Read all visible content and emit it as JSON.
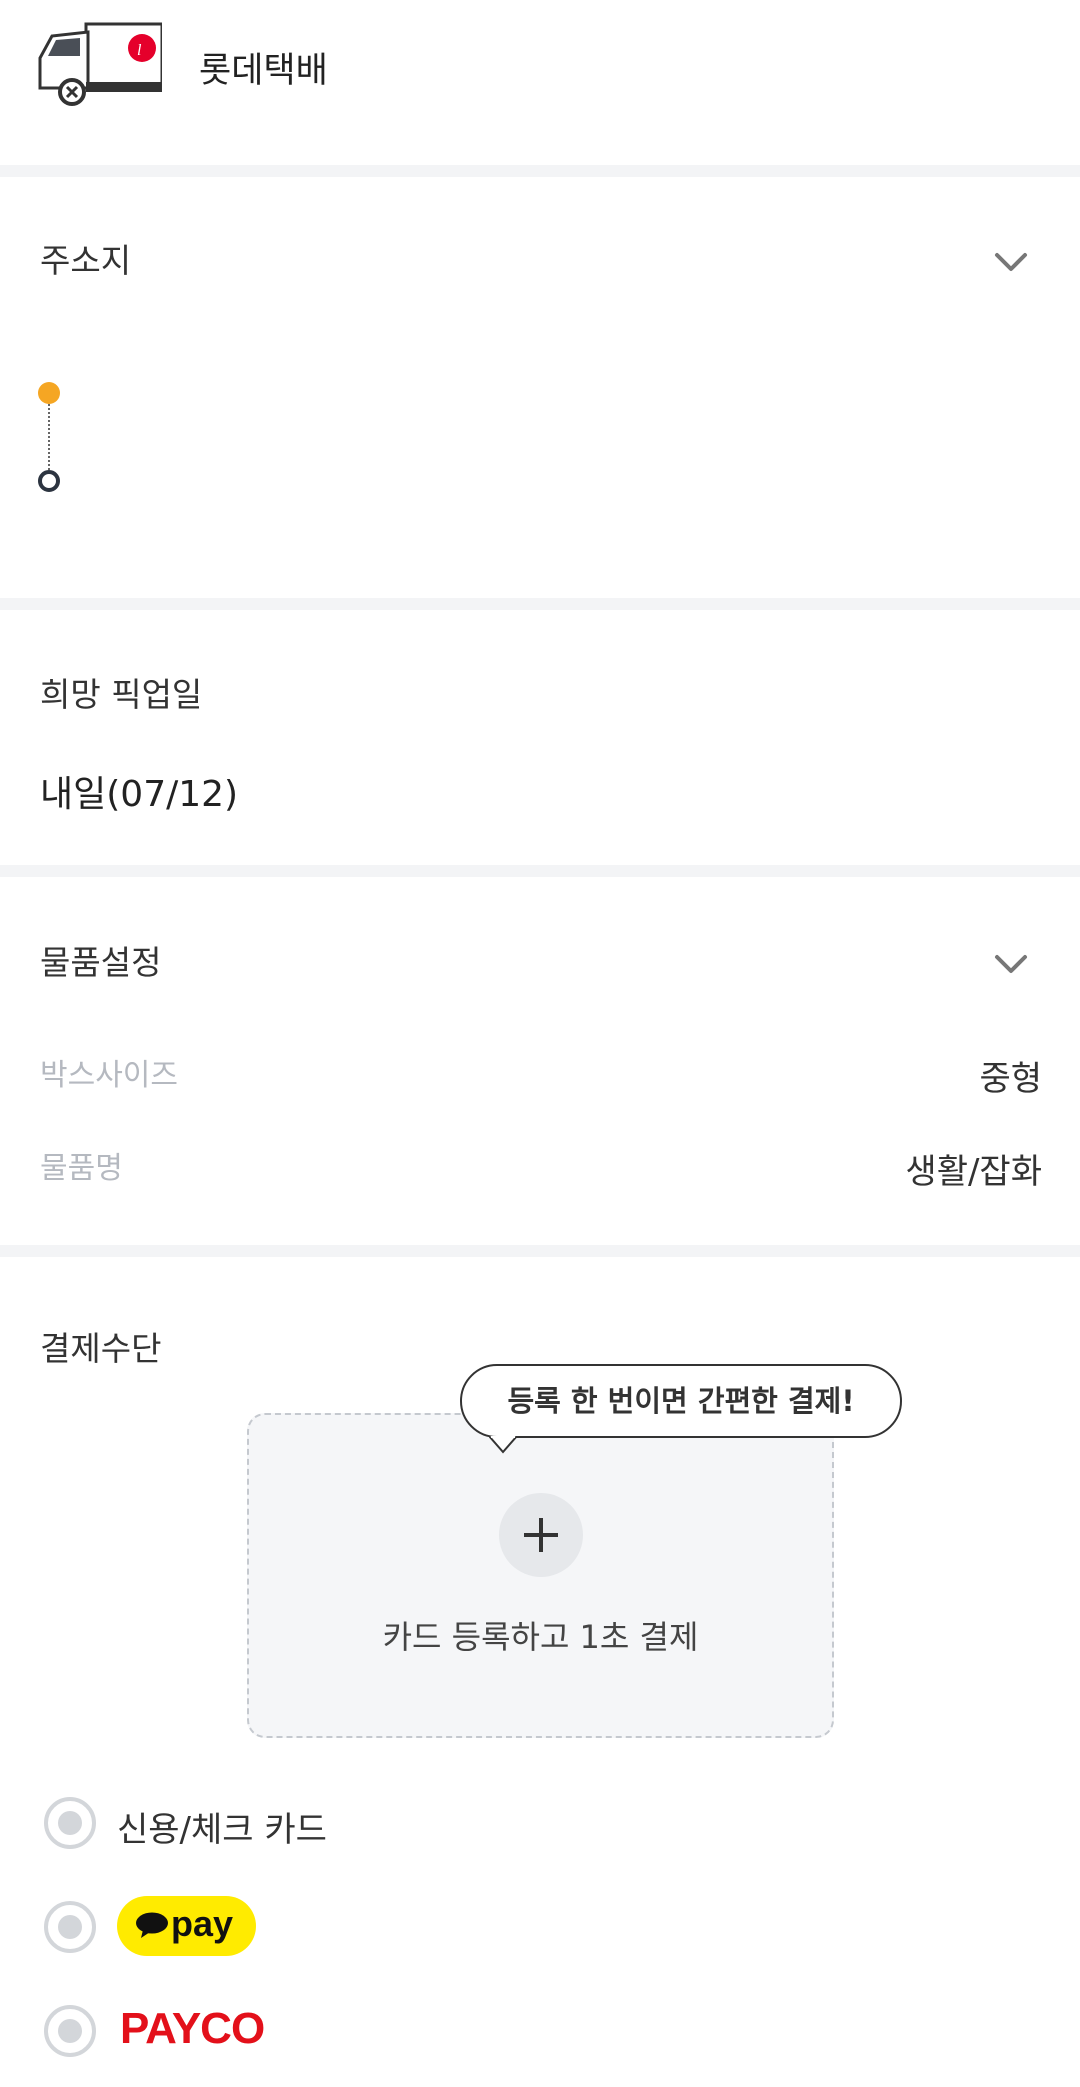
{
  "header": {
    "carrier_name": "롯데택배"
  },
  "address_section": {
    "title": "주소지"
  },
  "pickup_section": {
    "title": "희망 픽업일",
    "value": "내일(07/12)"
  },
  "item_section": {
    "title": "물품설정",
    "rows": [
      {
        "label": "박스사이즈",
        "value": "중형"
      },
      {
        "label": "물품명",
        "value": "생활/잡화"
      }
    ]
  },
  "payment_section": {
    "title": "결제수단",
    "tooltip": "등록 한 번이면 간편한 결제!",
    "card_register_text": "카드 등록하고 1초 결제",
    "options": [
      {
        "label": "신용/체크 카드"
      },
      {
        "label": "pay",
        "brand_color": "#ffeb00"
      },
      {
        "label": "PAYCO",
        "brand_color": "#e3101a"
      }
    ]
  },
  "colors": {
    "accent_orange": "#f5a623",
    "divider": "#f3f4f6"
  }
}
